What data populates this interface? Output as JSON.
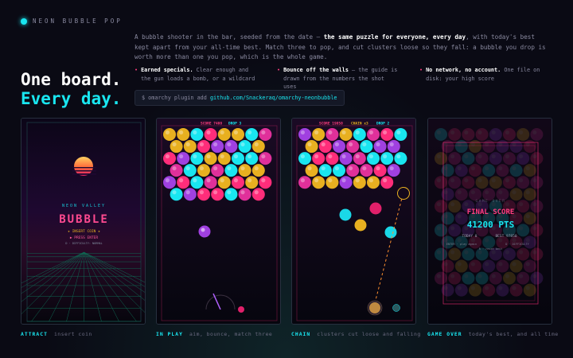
{
  "brand": {
    "name": "NEON BUBBLE POP"
  },
  "headline": {
    "line1": "One board.",
    "line2": "Every day."
  },
  "intro": {
    "p1": "A bubble shooter in the bar, seeded from the date — ",
    "p1_bold": "the same puzzle for everyone, every day",
    "p2": ", with today's best kept apart from your all-time best. Match three to pop, and cut clusters loose so they fall: a bubble you drop is worth more than one you pop, which is the whole game."
  },
  "features": [
    {
      "title": "Earned specials.",
      "text": "Clear enough and the gun loads a bomb, or a wildcard"
    },
    {
      "title": "Bounce off the walls",
      "text": "— the guide is drawn from the numbers the shot uses"
    },
    {
      "title": "No network, no account.",
      "text": "One file on disk: your high score"
    }
  ],
  "command": {
    "prefix": "$ omarchy plugin add ",
    "url": "github.com/Snackeraq/omarchy-neonbubble"
  },
  "screens": {
    "attract": {
      "subtitle": "NEON VALLEY",
      "title": "BUBBLE",
      "insert": "★ INSERT COIN ★",
      "press": "▶ PRESS ENTER",
      "difficulty": "D · DIFFICULTY: NORMAL"
    },
    "play": {
      "score": "SCORE 7400",
      "drop": "DROP 3"
    },
    "chain": {
      "score": "SCORE 19850",
      "chain": "CHAIN x3",
      "drop": "DROP 2"
    },
    "gameover": {
      "header": "GAME OVER",
      "title": "FINAL SCORE",
      "points": "41200 PTS",
      "today": "TODAY 0",
      "best": "BEST 97850",
      "enter": "ENTER · play again",
      "diff": "D · DIFFICULTY",
      "reset": "R · reset best"
    }
  },
  "captions": [
    {
      "tag": "ATTRACT",
      "desc": "insert coin"
    },
    {
      "tag": "IN PLAY",
      "desc": "aim, bounce, match three"
    },
    {
      "tag": "CHAIN",
      "desc": "clusters cut loose and falling"
    },
    {
      "tag": "GAME OVER",
      "desc": "today's best, and all time"
    }
  ],
  "colors": {
    "accent": "#19e6f0",
    "pink": "#ff2d7a",
    "magenta": "#e0309a",
    "gold": "#e8b020",
    "purple": "#a040e0",
    "orange": "#ff9030"
  }
}
